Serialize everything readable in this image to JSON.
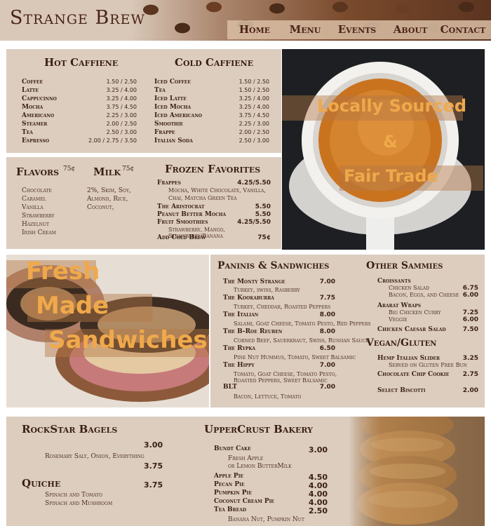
{
  "header": {
    "title": "Strange Brew",
    "nav": [
      "Home",
      "Menu",
      "Events",
      "About",
      "Contact"
    ]
  },
  "hot": {
    "title": "Hot Caffiene",
    "items": [
      {
        "name": "Coffee",
        "price": "1.50 / 2.50"
      },
      {
        "name": "Latte",
        "price": "3.25 / 4.00"
      },
      {
        "name": "Cappucinno",
        "price": "3.25 / 4.00"
      },
      {
        "name": "Mocha",
        "price": "3.75 / 4.50"
      },
      {
        "name": "Americano",
        "price": "2.25 / 3.00"
      },
      {
        "name": "Steamer",
        "price": "2.00 / 2.50"
      },
      {
        "name": "Tea",
        "price": "2.50 / 3.00"
      },
      {
        "name": "Espresso",
        "price": "2.00 / 2.75 / 3.50"
      }
    ]
  },
  "cold": {
    "title": "Cold Caffiene",
    "items": [
      {
        "name": "Iced Coffee",
        "price": "1.50 / 2.50"
      },
      {
        "name": "Tea",
        "price": "1.50 / 2.50"
      },
      {
        "name": "Iced Latte",
        "price": "3.25 / 4.00"
      },
      {
        "name": "Iced Mocha",
        "price": "3.25 / 4.00"
      },
      {
        "name": "Iced Americano",
        "price": "3.75 / 4.50"
      },
      {
        "name": "Smoothie",
        "price": "2.25 / 3.00"
      },
      {
        "name": "Frappe",
        "price": "2.00 / 2.50"
      },
      {
        "name": "Italian Soda",
        "price": "2.50 / 3.00"
      }
    ]
  },
  "flavors": {
    "title": "Flavors",
    "price": "75¢",
    "items": [
      "Chocolate",
      "Caramel",
      "Vanilla",
      "Strawberry",
      "Hazelnut",
      "Irish Cream"
    ]
  },
  "milk": {
    "title": "Milk",
    "price": "75¢",
    "lines": [
      "2%, Skim, Soy,",
      "Almond, Rice,",
      "Coconut,"
    ]
  },
  "frozen": {
    "title": "Frozen Favorites",
    "frappes": {
      "name": "Frappes",
      "price": "4.25/5.50",
      "desc1": "Mocha, White Chocolate, Vanilla,",
      "desc2": "Chai, Matcha Green Tea"
    },
    "aristocrat": {
      "name": "The Aristocrat",
      "price": "5.50"
    },
    "peanut": {
      "name": "Peanut Better Mocha",
      "price": "5.50"
    },
    "smoothies": {
      "name": "Fruit Smoothies",
      "price": "4.25/5.50",
      "desc": "Strawberry, Mango, Strawberry/Banana"
    },
    "coldbrew": {
      "name": "Add Cold Brew",
      "price": "75¢"
    }
  },
  "cup_overlay": {
    "line1": "Locally Sourced",
    "line2": "&",
    "line3": "Fair Trade"
  },
  "sandwich_overlay": {
    "line1": "Fresh",
    "line2": "Made",
    "line3": "Sandwiches"
  },
  "paninis": {
    "title": "Paninis & Sandwiches",
    "items": [
      {
        "name": "The Monty Strange",
        "price": "7.00",
        "desc": "Turkey, swiss, Rasberry"
      },
      {
        "name": "The Kookaburra",
        "price": "7.75",
        "desc": "Turkey, Cheddar, Roasted Peppers"
      },
      {
        "name": "The Italian",
        "price": "8.00",
        "desc": "Salami, Goat Cheese, Tomato Pesto, Red Peppers"
      },
      {
        "name": "The B-Roe Reuben",
        "price": "8.00",
        "desc": "Corned Beef, Sauerkraut, Swiss, Russian Sauce"
      },
      {
        "name": "The Rypka",
        "price": "6.50",
        "desc": "Pine Nut Hummus, Tomato, Sweet Balsamic"
      },
      {
        "name": "The Hippy",
        "price": "7.00",
        "desc": "Tomato, Goat Cheese, Tomato Pesto,",
        "desc2": "Roasted Peppers, Sweet Balsamic"
      },
      {
        "name": "BLT",
        "price": "7.00",
        "desc": "Bacon, Lettuce, Tomato"
      }
    ]
  },
  "other": {
    "title": "Other Sammies",
    "croissants": {
      "name": "Croissants",
      "opt1": "Chicken Salad",
      "price1": "6.75",
      "opt2": "Bacon, Eggs, and Cheese",
      "price2": "6.00"
    },
    "wraps": {
      "name": "Ararat Wraps",
      "opt1": "Big Chicken Curry",
      "price1": "7.25",
      "opt2": "Veggie",
      "price2": "6.00"
    },
    "caesar": {
      "name": "Chicken Caesar Salad",
      "price": "7.50"
    }
  },
  "vegan": {
    "title": "Vegan/Gluten",
    "slider": {
      "name": "Hemp Italian Slider",
      "price": "3.25",
      "desc": "Served on Gluten Free Bun"
    },
    "cookie": {
      "name": "Chocolate Chip Cookie",
      "price": "2.75"
    },
    "biscotti": {
      "name": "Select Biscotti",
      "price": "2.00"
    }
  },
  "bagels": {
    "title": "RockStar Bagels",
    "price1": "3.00",
    "desc": "Rosemary Salt, Onion, Everything",
    "price2": "3.75"
  },
  "quiche": {
    "title": "Quiche",
    "price": "3.75",
    "opt1": "Spinach and Tomato",
    "opt2": "Spinach and Mushroom"
  },
  "bakery": {
    "title": "UpperCrust Bakery",
    "bundt": {
      "name": "Bundt Cake",
      "price": "3.00",
      "desc1": "Fresh Apple",
      "desc2": "or Lemon ButterMilk"
    },
    "items": [
      {
        "name": "Apple Pie",
        "price": "4.50"
      },
      {
        "name": "Pecan Pie",
        "price": "4.00"
      },
      {
        "name": "Pumpkin Pie",
        "price": "4.00"
      },
      {
        "name": "Coconut Cream Pie",
        "price": "4.00"
      },
      {
        "name": "Tea Bread",
        "price": "2.50"
      }
    ],
    "teabread_desc": "Banana Nut, Pumpkin Nut"
  }
}
